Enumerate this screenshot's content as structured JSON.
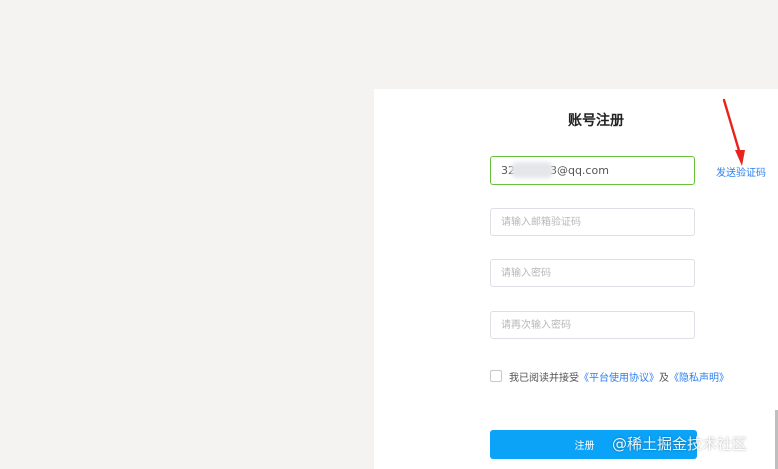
{
  "form": {
    "title": "账号注册",
    "email_value": "32          3@qq.com",
    "email_placeholder": "",
    "code_placeholder": "请输入邮箱验证码",
    "password_placeholder": "请输入密码",
    "confirm_password_placeholder": "请再次输入密码",
    "send_code_label": "发送验证码",
    "agree_prefix": "我已阅读并接受",
    "terms_link": "《平台使用协议》",
    "agree_and": "及",
    "privacy_link": "《隐私声明》",
    "submit_label": "注册",
    "submit_suffix": "注册"
  },
  "watermark": "@稀土掘金技术社区",
  "colors": {
    "accent": "#0aa3f8",
    "link": "#2b7ff0",
    "active_border": "#67c23a",
    "annotation_arrow": "#e8231d"
  }
}
